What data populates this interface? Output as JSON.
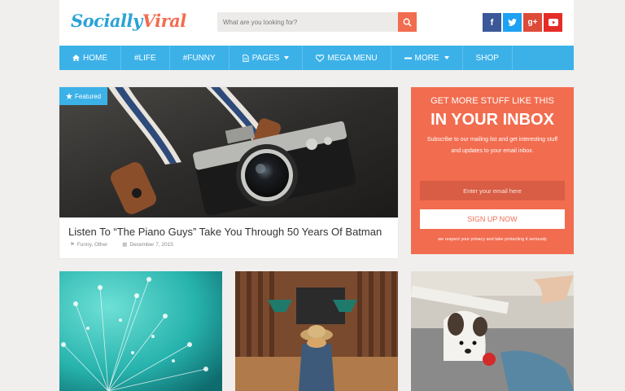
{
  "header": {
    "logo_part1": "Socially",
    "logo_part2": "Viral",
    "search_placeholder": "What are you looking for?",
    "social": [
      {
        "icon": "facebook-icon",
        "glyph": "f",
        "color": "#3b5998"
      },
      {
        "icon": "twitter-icon",
        "glyph": "t",
        "color": "#1da1f2"
      },
      {
        "icon": "google-plus-icon",
        "glyph": "g+",
        "color": "#dd4b39"
      },
      {
        "icon": "youtube-icon",
        "glyph": "▶",
        "color": "#e52d27"
      }
    ]
  },
  "nav": {
    "items": [
      {
        "label": "HOME",
        "icon": "home-icon"
      },
      {
        "label": "#LIFE"
      },
      {
        "label": "#FUNNY"
      },
      {
        "label": "PAGES",
        "icon": "file-icon",
        "dropdown": true
      },
      {
        "label": "MEGA MENU",
        "icon": "heart-icon"
      },
      {
        "label": "MORE",
        "icon": "minus-icon",
        "dropdown": true
      },
      {
        "label": "SHOP"
      }
    ]
  },
  "featured": {
    "badge": "Featured",
    "title": "Listen To “The Piano Guys” Take You Through 50 Years Of Batman",
    "categories": "Funny, Other",
    "date": "December 7, 2015"
  },
  "newsletter": {
    "heading1": "GET MORE STUFF LIKE THIS",
    "heading2": "IN YOUR INBOX",
    "description": "Subscribe to our mailing list and get interesting stuff and updates to your email inbox.",
    "email_placeholder": "Enter your email here",
    "button": "SIGN UP NOW",
    "note": "we respect your privacy and take protecting it seriously"
  },
  "colors": {
    "accent_blue": "#3cb1e8",
    "accent_orange": "#f26c4f"
  }
}
